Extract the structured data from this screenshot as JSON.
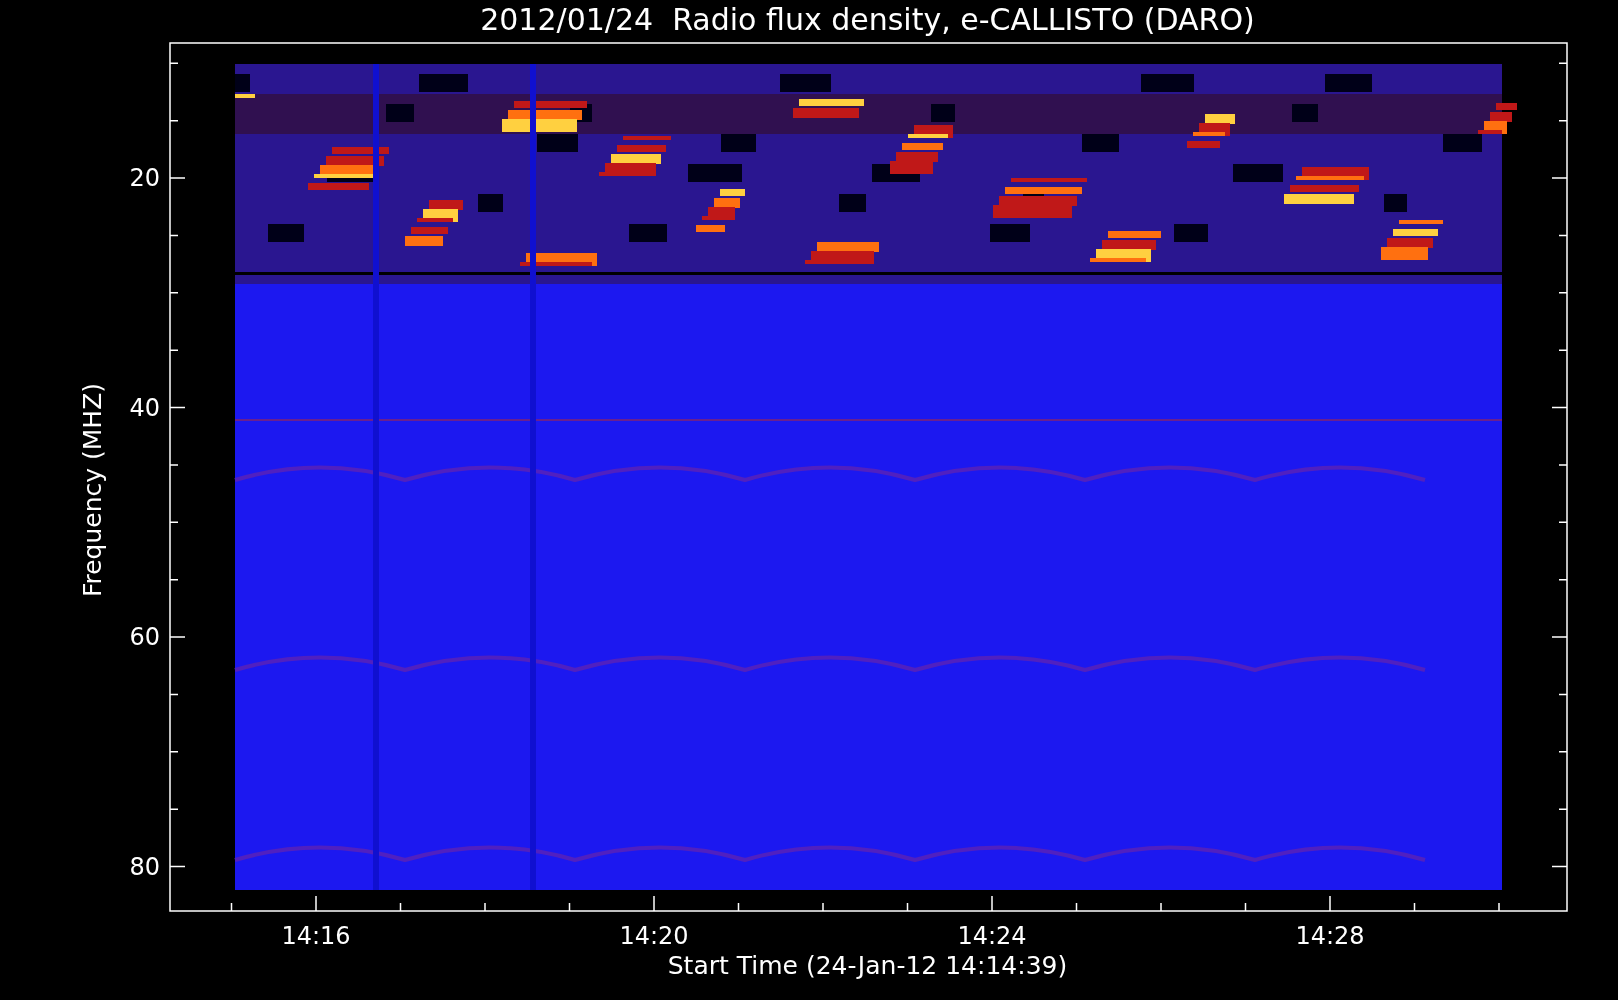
{
  "title": "2012/01/24  Radio flux density, e-CALLISTO (DARO)",
  "y_axis": {
    "label": "Frequency (MHZ)",
    "ticks": [
      "20",
      "40",
      "60",
      "80"
    ]
  },
  "x_axis": {
    "label": "Start Time (24-Jan-12 14:14:39)",
    "ticks": [
      "14:16",
      "14:20",
      "14:24",
      "14:28"
    ]
  }
}
